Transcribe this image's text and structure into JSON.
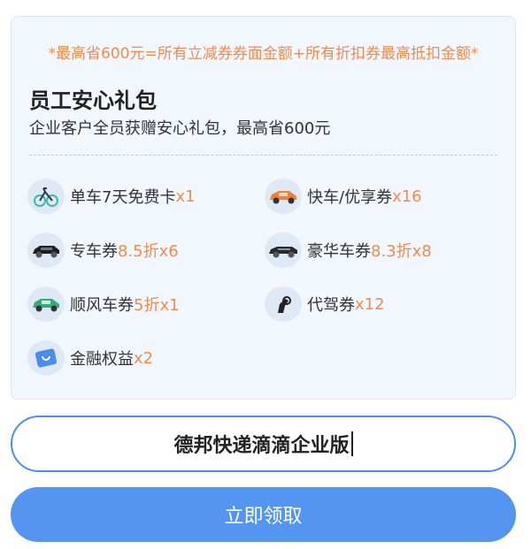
{
  "package": {
    "note": "*最高省600元=所有立减券券面金额+所有折扣券最高抵扣金额*",
    "title": "员工安心礼包",
    "description": "企业客户全员获赠安心礼包，最高省600元"
  },
  "benefits": [
    {
      "name": "单车7天免费卡",
      "value": "x1",
      "icon": "bicycle-icon"
    },
    {
      "name": "快车/优享券",
      "value": "x16",
      "icon": "orange-car-icon"
    },
    {
      "name": "专车券",
      "value": "8.5折x6",
      "icon": "black-car-icon"
    },
    {
      "name": "豪华车券",
      "value": "8.3折x8",
      "icon": "luxury-car-icon"
    },
    {
      "name": "顺风车券",
      "value": "5折x1",
      "icon": "green-car-icon"
    },
    {
      "name": "代驾券",
      "value": "x12",
      "icon": "steering-hand-icon"
    },
    {
      "name": "金融权益",
      "value": "x2",
      "icon": "card-icon"
    }
  ],
  "company_input": {
    "value": "德邦快递滴滴企业版"
  },
  "submit": {
    "label": "立即领取"
  },
  "colors": {
    "accent_orange": "#f28a4c",
    "primary_blue": "#5495f2",
    "card_bg": "#f2f7fd"
  }
}
